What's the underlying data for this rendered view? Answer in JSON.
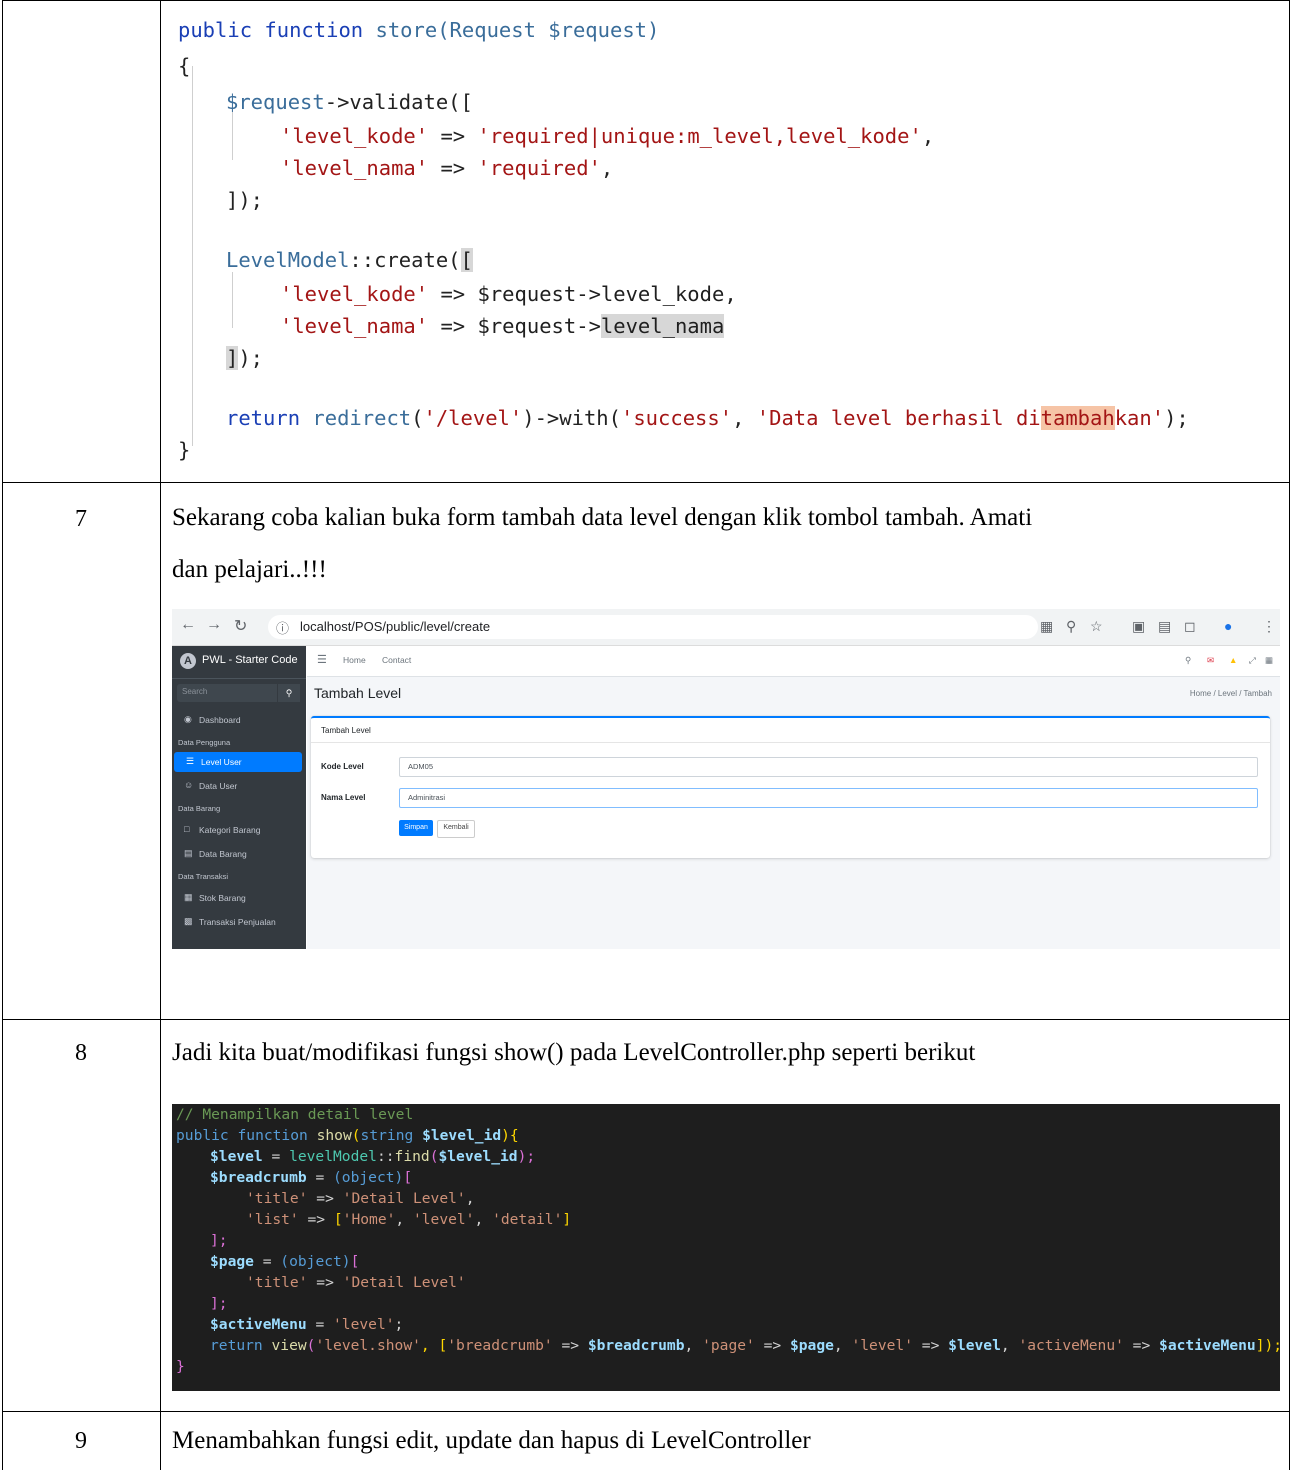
{
  "rows": [
    {
      "number": "7",
      "text_line1": "Sekarang coba kalian buka form tambah data level dengan klik tombol tambah. Amati",
      "text_line2": "dan pelajari..!!!"
    },
    {
      "number": "8",
      "text_line1": "Jadi kita buat/modifikasi fungsi show() pada LevelController.php seperti berikut"
    },
    {
      "number": "9",
      "text_line1": "Menambahkan fungsi edit, update dan hapus di LevelController"
    }
  ],
  "store_code": {
    "l1_kw": "public function ",
    "l1_fn": "store",
    "l1_rest": "(Request $request)",
    "l2": "{",
    "l3_a": "$request",
    "l3_b": "->validate([",
    "l4_key": "'level_kode'",
    "l4_arrow": " => ",
    "l4_val_a": "'required",
    "l4_val_b": "|unique:m_level,level_kode'",
    "l4_comma": ",",
    "l5_key": "'level_nama'",
    "l5_arrow": " => ",
    "l5_val": "'required'",
    "l5_comma": ",",
    "l6": "]);",
    "l7_a": "LevelModel",
    "l7_b": "::create(",
    "l7_c": "[",
    "l8_key": "'level_kode'",
    "l8_arrow": " => ",
    "l8_val": "$request->level_kode,",
    "l9_key": "'level_nama'",
    "l9_arrow": " => ",
    "l9_val_a": "$request->",
    "l9_val_b": "level_nama",
    "l10_a": "]",
    "l10_b": ");",
    "l11_kw": "return ",
    "l11_fn": "redirect",
    "l11_a": "(",
    "l11_s1": "'/level'",
    "l11_b": ")->with(",
    "l11_s2": "'success'",
    "l11_c": ", ",
    "l11_s3a": "'Data level berhasil di",
    "l11_s3b": "tambah",
    "l11_s3c": "kan'",
    "l11_d": ");",
    "l12": "}"
  },
  "browser": {
    "back_icon": "arrow-left-icon",
    "url": "localhost/POS/public/level/create",
    "brand": "PWL - Starter Code",
    "search_placeholder": "Search",
    "topnav": [
      "Home",
      "Contact"
    ],
    "menu": {
      "dashboard": "Dashboard",
      "group1": "Data Pengguna",
      "level_user": "Level User",
      "data_user": "Data User",
      "group2": "Data Barang",
      "kategori": "Kategori Barang",
      "data_barang": "Data Barang",
      "group3": "Data Transaksi",
      "stok": "Stok Barang",
      "transaksi": "Transaksi Penjualan"
    },
    "page_title": "Tambah Level",
    "breadcrumb": "Home / Level / Tambah",
    "card_title": "Tambah Level",
    "label_kode": "Kode Level",
    "value_kode": "ADM05",
    "label_nama": "Nama Level",
    "value_nama": "Adminitrasi",
    "btn_save": "Simpan",
    "btn_back": "Kembali",
    "accent": "#007bff"
  },
  "show_code": {
    "c1": "// Menampilkan detail level",
    "c2_kw": "public function ",
    "c2_fn": "show",
    "c2_a": "(",
    "c2_kw2": "string ",
    "c2_var": "$level_id",
    "c2_b": "){",
    "c3_var": "$level",
    "c3_a": " = ",
    "c3_cls": "levelModel",
    "c3_b": "::",
    "c3_fn": "find",
    "c3_c": "(",
    "c3_var2": "$level_id",
    "c3_d": ");",
    "c4_var": "$breadcrumb",
    "c4_a": " = ",
    "c4_kw": "(object)",
    "c4_b": "[",
    "c5_key": "'title'",
    "c5_a": " => ",
    "c5_val": "'Detail Level'",
    "c5_b": ",",
    "c6_key": "'list'",
    "c6_a": " => ",
    "c6_b": "[",
    "c6_v1": "'Home'",
    "c6_c": ", ",
    "c6_v2": "'level'",
    "c6_d": ", ",
    "c6_v3": "'detail'",
    "c6_e": "]",
    "c7": "];",
    "c8_var": "$page",
    "c8_a": " = ",
    "c8_kw": "(object)",
    "c8_b": "[",
    "c9_key": "'title'",
    "c9_a": " => ",
    "c9_val": "'Detail Level'",
    "c10": "];",
    "c11_var": "$activeMenu",
    "c11_a": " = ",
    "c11_val": "'level'",
    "c11_b": ";",
    "c12_kw": "return ",
    "c12_fn": "view",
    "c12_a": "(",
    "c12_s1": "'level.show'",
    "c12_b": ", [",
    "c12_k1": "'breadcrumb'",
    "c12_c": " => ",
    "c12_v1": "$breadcrumb",
    "c12_d": ", ",
    "c12_k2": "'page'",
    "c12_e": " => ",
    "c12_v2": "$page",
    "c12_f": ", ",
    "c12_k3": "'level'",
    "c12_g": " => ",
    "c12_v3": "$level",
    "c12_h": ", ",
    "c12_k4": "'activeMenu'",
    "c12_i": " => ",
    "c12_v4": "$activeMenu",
    "c12_j": "]);",
    "c13": "}"
  }
}
